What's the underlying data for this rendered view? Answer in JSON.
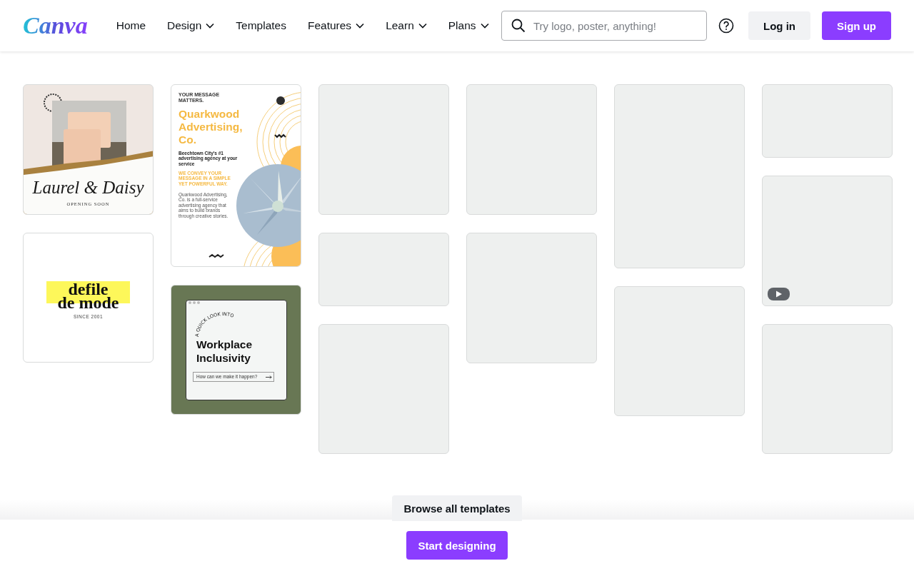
{
  "header": {
    "logo": "Canva",
    "nav": [
      {
        "label": "Home",
        "dropdown": false
      },
      {
        "label": "Design",
        "dropdown": true
      },
      {
        "label": "Templates",
        "dropdown": false
      },
      {
        "label": "Features",
        "dropdown": true
      },
      {
        "label": "Learn",
        "dropdown": true
      },
      {
        "label": "Plans",
        "dropdown": true
      }
    ],
    "search": {
      "placeholder": "Try logo, poster, anything!"
    },
    "buttons": [
      {
        "label": "Log in",
        "kind": "secondary"
      },
      {
        "label": "Sign up",
        "kind": "primary"
      }
    ]
  },
  "columns": [
    [
      {
        "kind": "soap",
        "title": "Laurel & Daisy",
        "subtitle": "OPENING SOON"
      },
      {
        "kind": "fashion",
        "title_lines": [
          "defile",
          "de mode"
        ],
        "subtitle": "SINCE 2001"
      }
    ],
    [
      {
        "kind": "agency",
        "eyebrow": "YOUR MESSAGE MATTERS.",
        "title": "Quarkwood Advertising, Co.",
        "tagline": "Beechtown City's #1 advertising agency at your service",
        "highlight": "WE CONVEY YOUR MESSAGE IN A SIMPLE YET POWERFUL WAY.",
        "body": "Quarkwood Advertising, Co. is a full-service advertising agency that aims to build brands through creative stories."
      },
      {
        "kind": "workplace",
        "arc_text": "A QUICK LOOK INTO",
        "title": "Workplace Inclusivity",
        "prompt": "How can we make it happen?"
      }
    ],
    [
      {
        "kind": "placeholder",
        "video": false
      },
      {
        "kind": "placeholder",
        "video": false
      },
      {
        "kind": "placeholder",
        "video": false
      }
    ],
    [
      {
        "kind": "placeholder",
        "video": false
      },
      {
        "kind": "placeholder",
        "video": false
      }
    ],
    [
      {
        "kind": "placeholder",
        "video": false
      },
      {
        "kind": "placeholder",
        "video": false
      }
    ],
    [
      {
        "kind": "placeholder",
        "video": false
      },
      {
        "kind": "placeholder",
        "video": true
      },
      {
        "kind": "placeholder",
        "video": false
      }
    ]
  ],
  "browse_button": "Browse all templates",
  "cta_button": "Start designing"
}
